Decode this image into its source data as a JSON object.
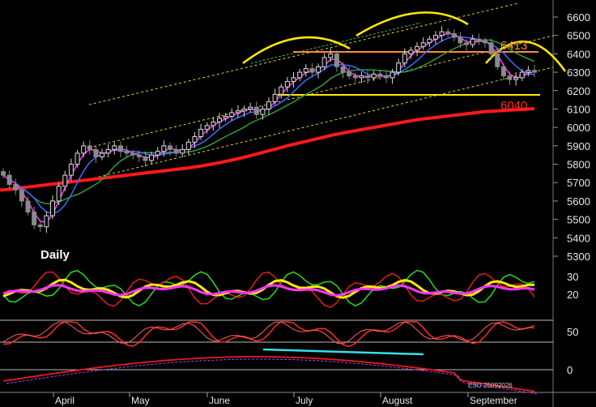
{
  "chart_data": {
    "type": "line",
    "period_label": "Daily",
    "code_label": "ESO 25092026",
    "months": [
      "April",
      "May",
      "June",
      "July",
      "August",
      "September"
    ],
    "y_ticks": [
      6600,
      6500,
      6400,
      6300,
      6200,
      6100,
      6000,
      5900,
      5800,
      5700,
      5600,
      5500,
      5400,
      5300
    ],
    "ylim": [
      5300,
      6650
    ],
    "levels": [
      {
        "label": "6413",
        "value": 6413,
        "color": "#ff8c3a"
      },
      {
        "label": "6040",
        "value": 6040,
        "color": "#ff2a2a"
      }
    ],
    "support_level": 6175,
    "price_close": [
      5740,
      5690,
      5660,
      5600,
      5540,
      5470,
      5460,
      5520,
      5600,
      5680,
      5740,
      5800,
      5860,
      5900,
      5880,
      5840,
      5860,
      5880,
      5900,
      5870,
      5860,
      5850,
      5840,
      5820,
      5850,
      5870,
      5900,
      5880,
      5860,
      5880,
      5920,
      5950,
      5990,
      6010,
      6030,
      6050,
      6060,
      6080,
      6090,
      6100,
      6110,
      6070,
      6100,
      6140,
      6180,
      6220,
      6250,
      6270,
      6300,
      6320,
      6300,
      6330,
      6380,
      6400,
      6330,
      6300,
      6280,
      6270,
      6280,
      6270,
      6290,
      6280,
      6270,
      6300,
      6350,
      6400,
      6420,
      6440,
      6460,
      6480,
      6500,
      6520,
      6510,
      6490,
      6460,
      6450,
      6480,
      6470,
      6460,
      6400,
      6330,
      6280,
      6260,
      6270,
      6300,
      6310,
      6300
    ],
    "moving_average_long": [
      5660,
      5664,
      5668,
      5672,
      5676,
      5680,
      5684,
      5688,
      5692,
      5696,
      5700,
      5704,
      5708,
      5712,
      5716,
      5720,
      5724,
      5728,
      5732,
      5736,
      5740,
      5744,
      5748,
      5752,
      5756,
      5760,
      5764,
      5768,
      5772,
      5776,
      5780,
      5785,
      5790,
      5796,
      5802,
      5808,
      5815,
      5822,
      5830,
      5838,
      5846,
      5855,
      5864,
      5873,
      5882,
      5891,
      5900,
      5908,
      5916,
      5924,
      5932,
      5940,
      5948,
      5956,
      5963,
      5970,
      5976,
      5982,
      5988,
      5994,
      6000,
      6006,
      6012,
      6018,
      6024,
      6030,
      6036,
      6042,
      6046,
      6050,
      6054,
      6058,
      6062,
      6066,
      6070,
      6074,
      6078,
      6082,
      6086,
      6088,
      6090,
      6092,
      6094,
      6096,
      6098,
      6100,
      6102
    ],
    "oscillator_levels": [
      30,
      20
    ],
    "stochastic_level": 50,
    "momentum_level": 0
  }
}
